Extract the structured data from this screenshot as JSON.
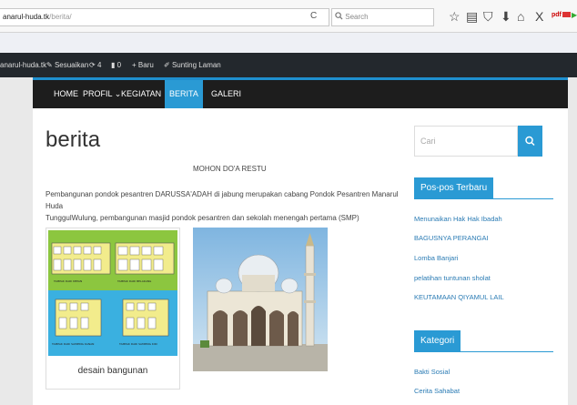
{
  "browser": {
    "url_host": "anarul-huda.tk",
    "url_path": "/berita/",
    "reload": "C",
    "search_placeholder": "Search",
    "pdf_icon_text": "pdf"
  },
  "admin_bar": {
    "site": "anarul-huda.tk",
    "customize": "Sesuaikan",
    "updates_count": "4",
    "comments_count": "0",
    "new": "Baru",
    "edit_page": "Sunting Laman"
  },
  "nav": {
    "items": [
      "HOME",
      "PROFIL",
      "KEGIATAN",
      "BERITA",
      "GALERI"
    ],
    "active": "BERITA"
  },
  "article": {
    "title": "berita",
    "blessing": "MOHON DO'A RESTU",
    "paragraph_line1": "Pembangunan  pondok pesantren DARUSSA'ADAH di jabung  merupakan cabang Pondok Pesantren Manarul Huda",
    "paragraph_line2": "TunggulWulung, pembangunan masjid pondok pesantren dan sekolah menengah pertama (SMP)",
    "image1_caption": "desain bangunan",
    "image1_labels": [
      "TAMPAK DARI DEPAN",
      "TAMPAK DARI BELAKANG",
      "TAMPAK DARI SAMPING KANAN",
      "TAMPAK DARI SAMPING KIRI"
    ]
  },
  "sidebar": {
    "search_placeholder": "Cari",
    "recent_posts_title": "Pos-pos Terbaru",
    "recent_posts": [
      "Menunaikan Hak Hak Ibadah",
      "BAGUSNYA PERANGAI",
      "Lomba Banjari",
      "pelatihan tuntunan sholat",
      "KEUTAMAAN QIYAMUL LAIL"
    ],
    "category_title": "Kategori",
    "categories": [
      "Bakti Sosial",
      "Cerita Sahabat"
    ]
  },
  "colors": {
    "accent": "#2a9ad4",
    "nav_bg": "#1d1d1d",
    "admin_bg": "#23282d",
    "link": "#2a7bb4"
  }
}
